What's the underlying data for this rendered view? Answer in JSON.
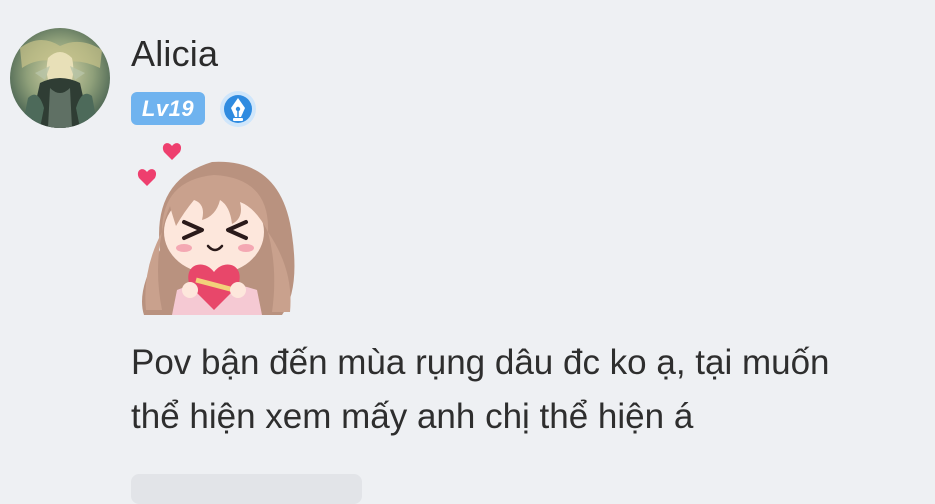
{
  "comment": {
    "author": {
      "name": "Alicia",
      "level": "Lv19",
      "avatar_icon": "avatar-knight-icon",
      "badge_icon": "pen-nib-badge-icon"
    },
    "sticker": {
      "icon": "girl-holding-heart-sticker-icon"
    },
    "text": "Pov bận đến mùa rụng dâu đc ko ạ, tại muốn\nthể hiện xem mấy anh chị thể hiện á"
  },
  "colors": {
    "background": "#eef0f3",
    "level_badge": "#6fb3ef",
    "pen_badge": "#2f8be0",
    "text": "#2e2e2e"
  }
}
